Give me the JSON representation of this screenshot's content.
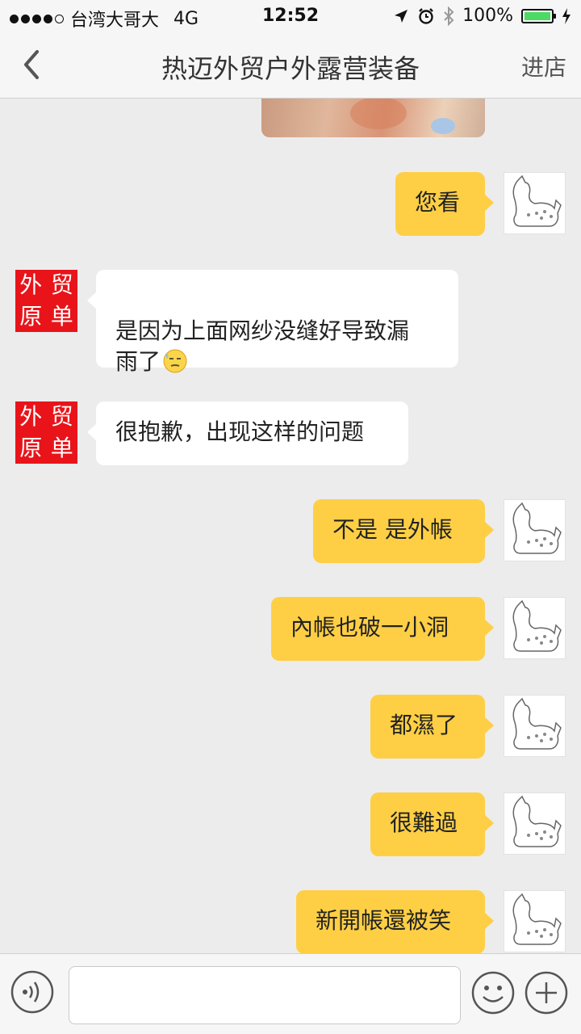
{
  "status_bar": {
    "carrier": "台湾大哥大",
    "network": "4G",
    "time": "12:52",
    "battery": "100%",
    "battery_level": 1.0,
    "icons": [
      "signal-dots-icon",
      "location-arrow-icon",
      "alarm-icon",
      "bluetooth-icon",
      "battery-icon",
      "charging-icon"
    ]
  },
  "nav": {
    "back_icon": "chevron-left-icon",
    "title": "热迈外贸户外露营装备",
    "right_label": "进店"
  },
  "merchant_avatar": {
    "chars": [
      "外",
      "贸",
      "原",
      "单"
    ]
  },
  "messages": [
    {
      "side": "out",
      "text": "您看"
    },
    {
      "side": "in",
      "text": "是因为上面网纱没缝好导致漏\n雨了",
      "emoji": "sweat-smile-emoji-icon"
    },
    {
      "side": "in",
      "text": "很抱歉，出现这样的问题"
    },
    {
      "side": "out",
      "text": "不是 是外帳"
    },
    {
      "side": "out",
      "text": "內帳也破一小洞"
    },
    {
      "side": "out",
      "text": "都濕了"
    },
    {
      "side": "out",
      "text": "很難過"
    },
    {
      "side": "out",
      "text": "新開帳還被笑"
    }
  ],
  "input_bar": {
    "placeholder": "",
    "icons": [
      "voice-icon",
      "emoji-icon",
      "plus-icon"
    ]
  },
  "colors": {
    "outgoing_bubble": "#fecf45",
    "incoming_bubble": "#ffffff",
    "background": "#ececec",
    "merchant_avatar": "#e8141a"
  }
}
